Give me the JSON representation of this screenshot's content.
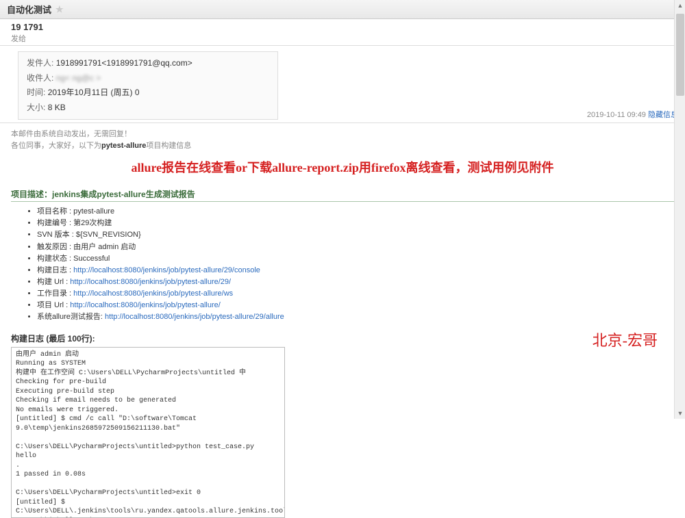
{
  "window": {
    "title": "自动化测试"
  },
  "header": {
    "sender": "19    1791",
    "to_prefix": "发给",
    "to_value": "",
    "timestamp": "2019-10-11 09:49",
    "hide_info": "隐藏信息"
  },
  "details": {
    "from_label": "发件人:",
    "from_value": "1918991791<1918991791@qq.com>",
    "to_label": "收件人:",
    "to_value": "    ng<   ng@c      >",
    "time_label": "时间:",
    "time_value": "2019年10月11日 (周五) 0",
    "size_label": "大小:",
    "size_value": "8 KB"
  },
  "sys_notes": {
    "line1": "本邮件由系统自动发出，无需回复！",
    "line2_pre": "各位同事，大家好，以下为",
    "line2_bold": "pytest-allure",
    "line2_post": "项目构建信息"
  },
  "headline": "allure报告在线查看or下载allure-report.zip用firefox离线查看，测试用例见附件",
  "section_desc": "项目描述：jenkins集成pytest-allure生成测试报告",
  "info": [
    {
      "k": "项目名称 :",
      "v": "pytest-allure"
    },
    {
      "k": "构建编号 :",
      "v": "第29次构建"
    },
    {
      "k": "SVN 版本 :",
      "v": "${SVN_REVISION}"
    },
    {
      "k": "触发原因 :",
      "v": "由用户 admin 启动"
    },
    {
      "k": "构建状态 :",
      "v": "Successful"
    },
    {
      "k": "构建日志 :",
      "link": "http://localhost:8080/jenkins/job/pytest-allure/29/console"
    },
    {
      "k": "构建 Url :",
      "link": "http://localhost:8080/jenkins/job/pytest-allure/29/"
    },
    {
      "k": "工作目录 :",
      "link": "http://localhost:8080/jenkins/job/pytest-allure/ws"
    },
    {
      "k": "项目 Url :",
      "link": "http://localhost:8080/jenkins/job/pytest-allure/"
    },
    {
      "k": "系统allure测试报告:",
      "link": "http://localhost:8080/jenkins/job/pytest-allure/29/allure"
    }
  ],
  "log_title": "构建日志 (最后 100行):",
  "log_text": "由用户 admin 启动\nRunning as SYSTEM\n构建中 在工作空间 C:\\Users\\DELL\\PycharmProjects\\untitled 中\nChecking for pre-build\nExecuting pre-build step\nChecking if email needs to be generated\nNo emails were triggered.\n[untitled] $ cmd /c call \"D:\\software\\Tomcat 9.0\\temp\\jenkins2685972509156211130.bat\"\n\nC:\\Users\\DELL\\PycharmProjects\\untitled>python test_case.py\nhello\n.\n1 passed in 0.08s\n\nC:\\Users\\DELL\\PycharmProjects\\untitled>exit 0\n[untitled] $\nC:\\Users\\DELL\\.jenkins\\tools\\ru.yandex.qatools.allure.jenkins.tools.AllureCommandlineInstallation\\allure-2.13.0\\bin\\allure.bat generate C:\\Users\\DELL\\PycharmProjects\\untitled\\report -c -o C:\\Users\\DELL\\PycharmProjects\\untitled\\allure-report\nReport successfully generated to C:\\Users\\DELL\\PycharmProjects\\untitled\\allure-report\nAllure report was successfully generated.\nCreating artifact for the build.",
  "watermark": "北京-宏哥"
}
